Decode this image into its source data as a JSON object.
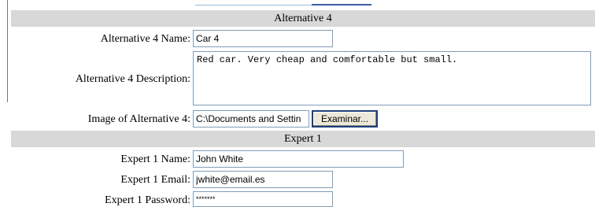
{
  "alternative_section": {
    "header": "Alternative 4",
    "name_label": "Alternative 4 Name:",
    "name_value": "Car 4",
    "description_label": "Alternative 4 Description:",
    "description_value": "Red car. Very cheap and comfortable but small.",
    "image_label": "Image of Alternative 4:",
    "image_value": "C:\\Documents and Settin",
    "browse_label": "Examinar..."
  },
  "expert_section": {
    "header": "Expert 1",
    "name_label": "Expert 1 Name:",
    "name_value": "John White",
    "email_label": "Expert 1 Email:",
    "email_value": "jwhite@email.es",
    "password_label": "Expert 1 Password:",
    "password_value": "*******"
  }
}
